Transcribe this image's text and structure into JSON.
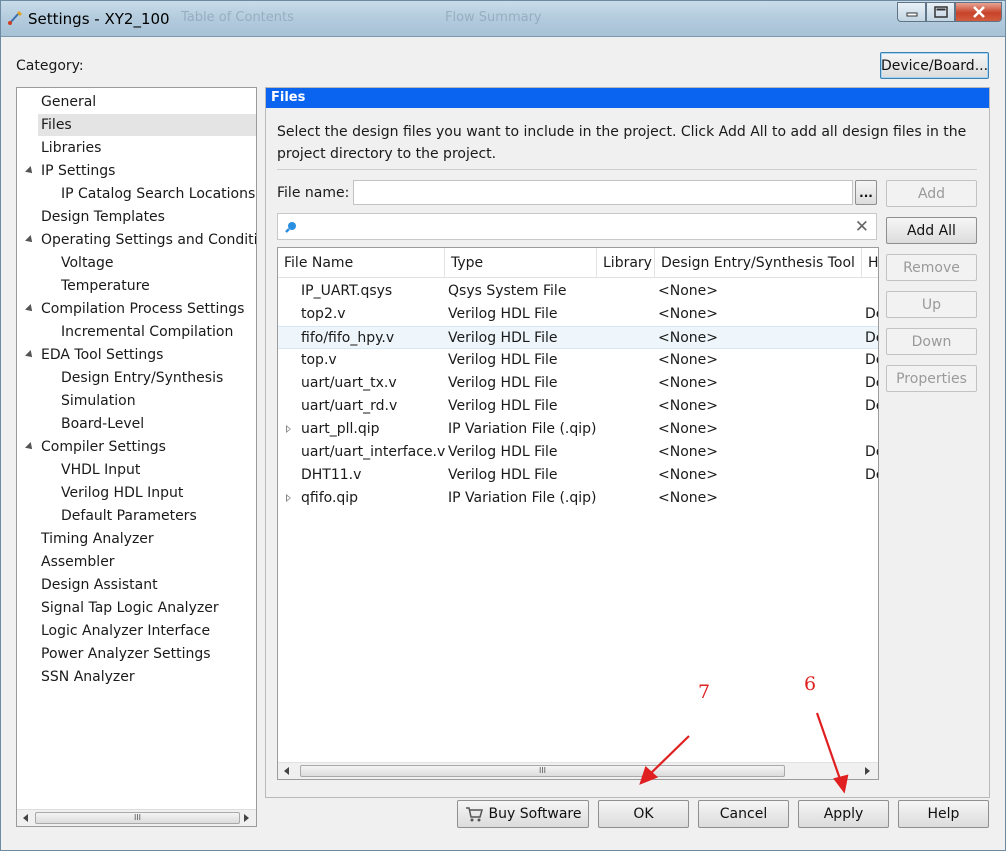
{
  "window": {
    "title": "Settings - XY2_100",
    "ghost_title_1": "Table of Contents",
    "ghost_title_2": "Flow Summary"
  },
  "category_label": "Category:",
  "device_board_button": "Device/Board...",
  "tree": {
    "items": [
      {
        "label": "General",
        "level": 0,
        "caret": false
      },
      {
        "label": "Files",
        "level": 0,
        "caret": false,
        "selected": true
      },
      {
        "label": "Libraries",
        "level": 0,
        "caret": false
      },
      {
        "label": "IP Settings",
        "level": 0,
        "caret": true
      },
      {
        "label": "IP Catalog Search Locations",
        "level": 1,
        "caret": false
      },
      {
        "label": "Design Templates",
        "level": 0,
        "caret": false
      },
      {
        "label": "Operating Settings and Conditions",
        "level": 0,
        "caret": true
      },
      {
        "label": "Voltage",
        "level": 1,
        "caret": false
      },
      {
        "label": "Temperature",
        "level": 1,
        "caret": false
      },
      {
        "label": "Compilation Process Settings",
        "level": 0,
        "caret": true
      },
      {
        "label": "Incremental Compilation",
        "level": 1,
        "caret": false
      },
      {
        "label": "EDA Tool Settings",
        "level": 0,
        "caret": true
      },
      {
        "label": "Design Entry/Synthesis",
        "level": 1,
        "caret": false
      },
      {
        "label": "Simulation",
        "level": 1,
        "caret": false
      },
      {
        "label": "Board-Level",
        "level": 1,
        "caret": false
      },
      {
        "label": "Compiler Settings",
        "level": 0,
        "caret": true
      },
      {
        "label": "VHDL Input",
        "level": 1,
        "caret": false
      },
      {
        "label": "Verilog HDL Input",
        "level": 1,
        "caret": false
      },
      {
        "label": "Default Parameters",
        "level": 1,
        "caret": false
      },
      {
        "label": "Timing Analyzer",
        "level": 0,
        "caret": false
      },
      {
        "label": "Assembler",
        "level": 0,
        "caret": false
      },
      {
        "label": "Design Assistant",
        "level": 0,
        "caret": false
      },
      {
        "label": "Signal Tap Logic Analyzer",
        "level": 0,
        "caret": false
      },
      {
        "label": "Logic Analyzer Interface",
        "level": 0,
        "caret": false
      },
      {
        "label": "Power Analyzer Settings",
        "level": 0,
        "caret": false
      },
      {
        "label": "SSN Analyzer",
        "level": 0,
        "caret": false
      }
    ]
  },
  "panel": {
    "header": "Files",
    "description": "Select the design files you want to include in the project. Click Add All to add all design files in the project directory to the project.",
    "file_name_label": "File name:",
    "file_name_value": "",
    "browse_label": "...",
    "search_value": ""
  },
  "table": {
    "columns": [
      "File Name",
      "Type",
      "Library",
      "Design Entry/Synthesis Tool",
      "H"
    ],
    "rows": [
      {
        "name": "IP_UART.qsys",
        "type": "Qsys System File",
        "library": "",
        "tool": "<None>",
        "h": "",
        "expandable": false
      },
      {
        "name": "top2.v",
        "type": "Verilog HDL File",
        "library": "",
        "tool": "<None>",
        "h": "De",
        "expandable": false
      },
      {
        "name": "fifo/fifo_hpy.v",
        "type": "Verilog HDL File",
        "library": "",
        "tool": "<None>",
        "h": "De",
        "expandable": false,
        "hover": true
      },
      {
        "name": "top.v",
        "type": "Verilog HDL File",
        "library": "",
        "tool": "<None>",
        "h": "De",
        "expandable": false
      },
      {
        "name": "uart/uart_tx.v",
        "type": "Verilog HDL File",
        "library": "",
        "tool": "<None>",
        "h": "De",
        "expandable": false
      },
      {
        "name": "uart/uart_rd.v",
        "type": "Verilog HDL File",
        "library": "",
        "tool": "<None>",
        "h": "De",
        "expandable": false
      },
      {
        "name": "uart_pll.qip",
        "type": "IP Variation File (.qip)",
        "library": "",
        "tool": "<None>",
        "h": "",
        "expandable": true
      },
      {
        "name": "uart/uart_interface.v",
        "type": "Verilog HDL File",
        "library": "",
        "tool": "<None>",
        "h": "De",
        "expandable": false
      },
      {
        "name": "DHT11.v",
        "type": "Verilog HDL File",
        "library": "",
        "tool": "<None>",
        "h": "De",
        "expandable": false
      },
      {
        "name": "qfifo.qip",
        "type": "IP Variation File (.qip)",
        "library": "",
        "tool": "<None>",
        "h": "",
        "expandable": true
      }
    ]
  },
  "side_buttons": {
    "add": "Add",
    "add_all": "Add All",
    "remove": "Remove",
    "up": "Up",
    "down": "Down",
    "properties": "Properties"
  },
  "bottom_buttons": {
    "buy_software": "Buy Software",
    "ok": "OK",
    "cancel": "Cancel",
    "apply": "Apply",
    "help": "Help"
  },
  "annotations": {
    "label_7": "7",
    "label_6": "6",
    "color": "#e02020"
  },
  "colors": {
    "panel_header": "#0a64ef",
    "title_bar": "#b3cbdd"
  }
}
